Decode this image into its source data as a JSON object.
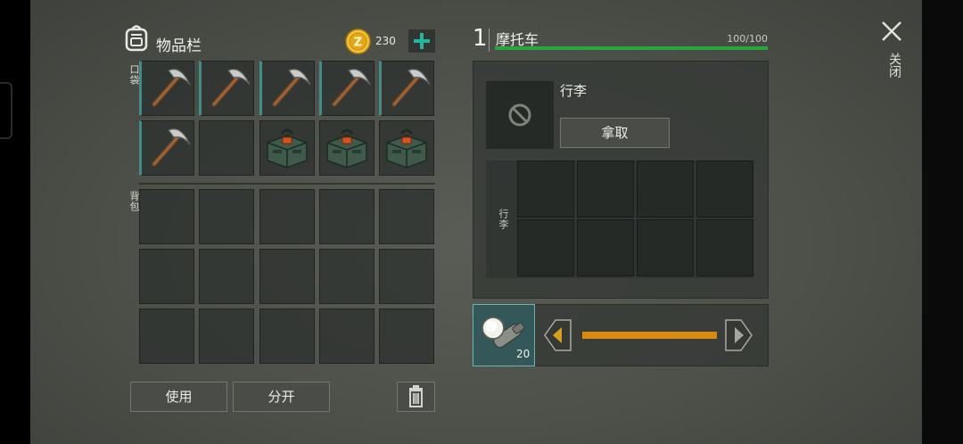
{
  "inventory": {
    "title": "物品栏",
    "coins": "230",
    "pocket_label": "口袋",
    "backpack_label": "背包",
    "pocket_items": [
      "pickaxe",
      "pickaxe",
      "pickaxe",
      "pickaxe",
      "pickaxe",
      "pickaxe",
      "empty",
      "supply-crate",
      "supply-crate",
      "supply-crate"
    ],
    "use_label": "使用",
    "split_label": "分开"
  },
  "vehicle": {
    "level": "1",
    "name": "摩托车",
    "durability_text": "100/100",
    "durability_fraction": 1.0,
    "luggage_title": "行李",
    "take_label": "拿取",
    "luggage_grid_label": "行李"
  },
  "fuel": {
    "item_count": "20",
    "slider_fraction": 1.0
  },
  "close": {
    "label": "关闭"
  },
  "colors": {
    "accent_green": "#27a83d",
    "teal": "#3f8e8a",
    "orange": "#d98a11",
    "gold": "#e9b21d"
  }
}
